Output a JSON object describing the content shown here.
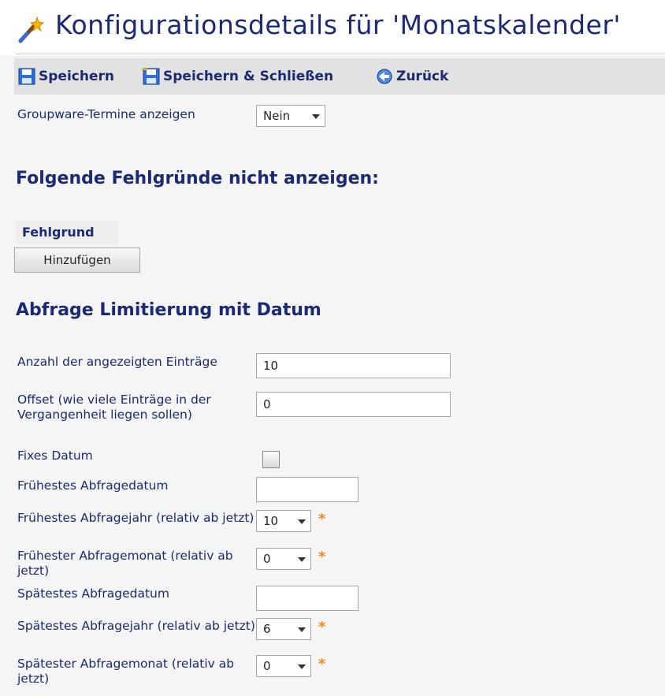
{
  "header": {
    "title": "Konfigurationsdetails für 'Monatskalender'",
    "icon": "magic-wand-icon"
  },
  "toolbar": {
    "save_label": "Speichern",
    "save_close_label": "Speichern & Schließen",
    "back_label": "Zurück"
  },
  "groupware": {
    "label": "Groupware-Termine anzeigen",
    "value": "Nein"
  },
  "absence_section": {
    "heading": "Folgende Fehlgründe nicht anzeigen:",
    "column_header": "Fehlgrund",
    "add_button": "Hinzufügen"
  },
  "limit_section": {
    "heading": "Abfrage Limitierung mit Datum",
    "entries_label": "Anzahl der angezeigten Einträge",
    "entries_value": "10",
    "offset_label": "Offset (wie viele Einträge in der Vergangenheit liegen sollen)",
    "offset_value": "0",
    "fixed_date_label": "Fixes Datum",
    "fixed_date_checked": false,
    "earliest_date_label": "Frühestes Abfragedatum",
    "earliest_date_value": "",
    "earliest_year_label": "Frühestes Abfragejahr (relativ ab jetzt)",
    "earliest_year_value": "10",
    "earliest_month_label": "Frühester Abfragemonat (relativ ab jetzt)",
    "earliest_month_value": "0",
    "latest_date_label": "Spätestes Abfragedatum",
    "latest_date_value": "",
    "latest_year_label": "Spätestes Abfragejahr (relativ ab jetzt)",
    "latest_year_value": "6",
    "latest_month_label": "Spätester Abfragemonat (relativ ab jetzt)",
    "latest_month_value": "0",
    "required_marker": "*"
  },
  "colors": {
    "heading": "#1b2a72",
    "toolbar_bg": "#e2e2e2",
    "required": "#f08a1c"
  }
}
